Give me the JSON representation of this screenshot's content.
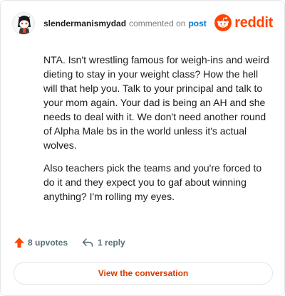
{
  "header": {
    "username": "slendermanismydad",
    "action_text": "commented on",
    "post_link": "post",
    "brand": "reddit"
  },
  "comment": {
    "paragraphs": [
      "NTA. Isn't wrestling famous for weigh-ins and weird dieting to stay in your weight class? How the hell will that help you. Talk to your principal and talk to your mom again. Your dad is being an AH and she needs to deal with it. We don't need another round of Alpha Male bs in the world unless it's actual wolves.",
      "Also teachers pick the teams and you're forced to do it and they expect you to gaf about winning anything? I'm rolling my eyes."
    ]
  },
  "actions": {
    "upvotes": "8 upvotes",
    "replies": "1 reply"
  },
  "cta": {
    "label": "View the conversation"
  },
  "colors": {
    "brand": "#ff4500",
    "cta": "#d93a00",
    "link": "#0079d3"
  }
}
